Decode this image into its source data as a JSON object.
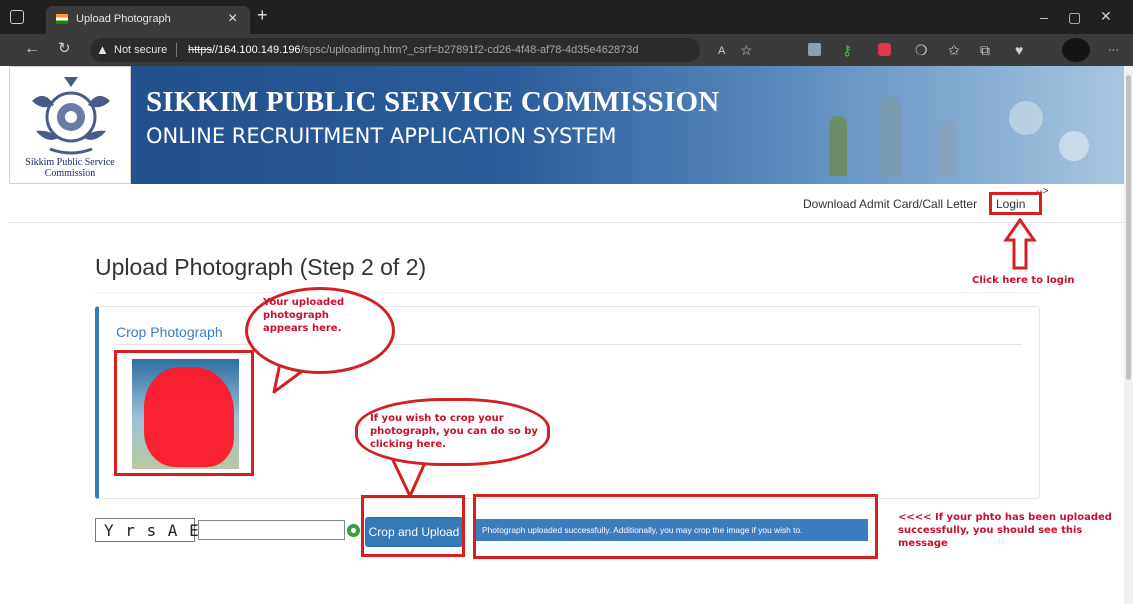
{
  "browser": {
    "tab_title": "Upload Photograph",
    "tab_close": "×",
    "new_tab": "+",
    "security_label": "Not secure",
    "url_scheme": "https",
    "url_host": "//164.100.149.196",
    "url_path": "/spsc/uploadimg.htm?_csrf=b27891f2-cd26-4f48-af78-4d35e462873d",
    "menu_dots": "···"
  },
  "banner": {
    "title": "SIKKIM PUBLIC SERVICE COMMISSION",
    "subtitle": "ONLINE RECRUITMENT APPLICATION SYSTEM",
    "emblem_caption": "Sikkim Public Service Commission"
  },
  "nav": {
    "admit_card": "Download Admit Card/Call Letter",
    "login": "Login",
    "stray_text": "-->"
  },
  "page": {
    "title": "Upload Photograph (Step 2 of 2)",
    "crop_heading": "Crop Photograph",
    "captcha_text": "Y r s A E",
    "captcha_input_value": "",
    "crop_upload_button": "Crop and Upload",
    "success_message": "Photograph uploaded successfully. Additionally, you may crop the image if you wish to."
  },
  "annotations": {
    "login_hint": "Click here to login",
    "photo_bubble": "Your uploaded photograph appears here.",
    "crop_bubble": "If you wish to crop your photograph, you can do so by clicking here.",
    "success_hint": "<<<< If your phto has been uploaded successfully, you should see this message"
  },
  "colors": {
    "annotation_red": "#d42020",
    "button_blue": "#337ab7",
    "panel_accent": "#337ab7",
    "heading_blue": "#3c7cc1"
  }
}
